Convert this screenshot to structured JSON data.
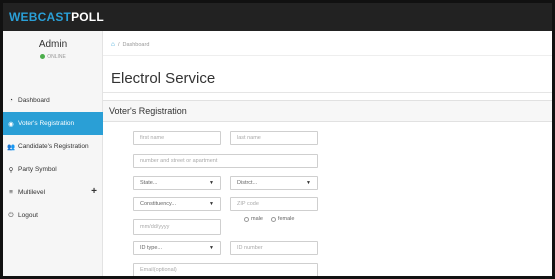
{
  "brand": {
    "part1": "WEBCAST",
    "part2": "POLL"
  },
  "user": {
    "name": "Admin",
    "status": "ONLINE"
  },
  "sidebar": {
    "items": [
      {
        "label": "Dashboard"
      },
      {
        "label": "Voter's Registration"
      },
      {
        "label": "Candidate's Registration"
      },
      {
        "label": "Party Symbol"
      },
      {
        "label": "Multilevel"
      },
      {
        "label": "Logout"
      }
    ]
  },
  "breadcrumb": {
    "home_icon": "home-icon",
    "current": "Dashboard"
  },
  "page": {
    "title": "Electrol Service"
  },
  "panel": {
    "title": "Voter's Registration"
  },
  "form": {
    "first_name": {
      "placeholder": "first name"
    },
    "last_name": {
      "placeholder": "last name"
    },
    "address": {
      "placeholder": "number and street or apartment"
    },
    "state": {
      "value": "State..."
    },
    "district": {
      "value": "Distrct..."
    },
    "constituency": {
      "value": "Constituency..."
    },
    "zip": {
      "placeholder": "ZIP code"
    },
    "dob": {
      "placeholder": "mm/dd/yyyy"
    },
    "gender": {
      "male": "male",
      "female": "female"
    },
    "id_type": {
      "value": "ID type..."
    },
    "id_number": {
      "placeholder": "ID number"
    },
    "email": {
      "placeholder": "Email(optional)"
    }
  },
  "colors": {
    "accent": "#2a9fd6",
    "topbar": "#222222",
    "online": "#4cae4c"
  }
}
